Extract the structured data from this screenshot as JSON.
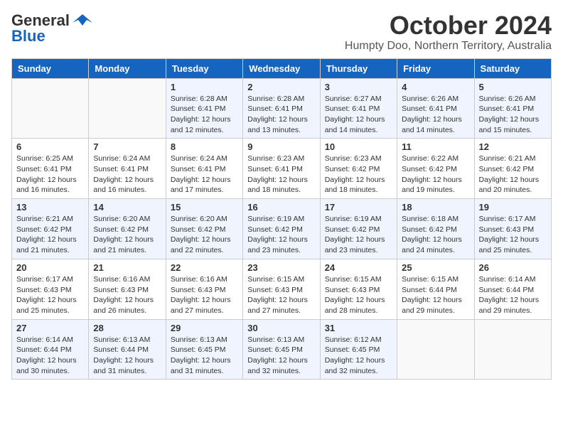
{
  "logo": {
    "text_general": "General",
    "text_blue": "Blue"
  },
  "title": "October 2024",
  "subtitle": "Humpty Doo, Northern Territory, Australia",
  "days": [
    "Sunday",
    "Monday",
    "Tuesday",
    "Wednesday",
    "Thursday",
    "Friday",
    "Saturday"
  ],
  "weeks": [
    [
      {
        "date": "",
        "sunrise": "",
        "sunset": "",
        "daylight": ""
      },
      {
        "date": "",
        "sunrise": "",
        "sunset": "",
        "daylight": ""
      },
      {
        "date": "1",
        "sunrise": "Sunrise: 6:28 AM",
        "sunset": "Sunset: 6:41 PM",
        "daylight": "Daylight: 12 hours and 12 minutes."
      },
      {
        "date": "2",
        "sunrise": "Sunrise: 6:28 AM",
        "sunset": "Sunset: 6:41 PM",
        "daylight": "Daylight: 12 hours and 13 minutes."
      },
      {
        "date": "3",
        "sunrise": "Sunrise: 6:27 AM",
        "sunset": "Sunset: 6:41 PM",
        "daylight": "Daylight: 12 hours and 14 minutes."
      },
      {
        "date": "4",
        "sunrise": "Sunrise: 6:26 AM",
        "sunset": "Sunset: 6:41 PM",
        "daylight": "Daylight: 12 hours and 14 minutes."
      },
      {
        "date": "5",
        "sunrise": "Sunrise: 6:26 AM",
        "sunset": "Sunset: 6:41 PM",
        "daylight": "Daylight: 12 hours and 15 minutes."
      }
    ],
    [
      {
        "date": "6",
        "sunrise": "Sunrise: 6:25 AM",
        "sunset": "Sunset: 6:41 PM",
        "daylight": "Daylight: 12 hours and 16 minutes."
      },
      {
        "date": "7",
        "sunrise": "Sunrise: 6:24 AM",
        "sunset": "Sunset: 6:41 PM",
        "daylight": "Daylight: 12 hours and 16 minutes."
      },
      {
        "date": "8",
        "sunrise": "Sunrise: 6:24 AM",
        "sunset": "Sunset: 6:41 PM",
        "daylight": "Daylight: 12 hours and 17 minutes."
      },
      {
        "date": "9",
        "sunrise": "Sunrise: 6:23 AM",
        "sunset": "Sunset: 6:41 PM",
        "daylight": "Daylight: 12 hours and 18 minutes."
      },
      {
        "date": "10",
        "sunrise": "Sunrise: 6:23 AM",
        "sunset": "Sunset: 6:42 PM",
        "daylight": "Daylight: 12 hours and 18 minutes."
      },
      {
        "date": "11",
        "sunrise": "Sunrise: 6:22 AM",
        "sunset": "Sunset: 6:42 PM",
        "daylight": "Daylight: 12 hours and 19 minutes."
      },
      {
        "date": "12",
        "sunrise": "Sunrise: 6:21 AM",
        "sunset": "Sunset: 6:42 PM",
        "daylight": "Daylight: 12 hours and 20 minutes."
      }
    ],
    [
      {
        "date": "13",
        "sunrise": "Sunrise: 6:21 AM",
        "sunset": "Sunset: 6:42 PM",
        "daylight": "Daylight: 12 hours and 21 minutes."
      },
      {
        "date": "14",
        "sunrise": "Sunrise: 6:20 AM",
        "sunset": "Sunset: 6:42 PM",
        "daylight": "Daylight: 12 hours and 21 minutes."
      },
      {
        "date": "15",
        "sunrise": "Sunrise: 6:20 AM",
        "sunset": "Sunset: 6:42 PM",
        "daylight": "Daylight: 12 hours and 22 minutes."
      },
      {
        "date": "16",
        "sunrise": "Sunrise: 6:19 AM",
        "sunset": "Sunset: 6:42 PM",
        "daylight": "Daylight: 12 hours and 23 minutes."
      },
      {
        "date": "17",
        "sunrise": "Sunrise: 6:19 AM",
        "sunset": "Sunset: 6:42 PM",
        "daylight": "Daylight: 12 hours and 23 minutes."
      },
      {
        "date": "18",
        "sunrise": "Sunrise: 6:18 AM",
        "sunset": "Sunset: 6:42 PM",
        "daylight": "Daylight: 12 hours and 24 minutes."
      },
      {
        "date": "19",
        "sunrise": "Sunrise: 6:17 AM",
        "sunset": "Sunset: 6:43 PM",
        "daylight": "Daylight: 12 hours and 25 minutes."
      }
    ],
    [
      {
        "date": "20",
        "sunrise": "Sunrise: 6:17 AM",
        "sunset": "Sunset: 6:43 PM",
        "daylight": "Daylight: 12 hours and 25 minutes."
      },
      {
        "date": "21",
        "sunrise": "Sunrise: 6:16 AM",
        "sunset": "Sunset: 6:43 PM",
        "daylight": "Daylight: 12 hours and 26 minutes."
      },
      {
        "date": "22",
        "sunrise": "Sunrise: 6:16 AM",
        "sunset": "Sunset: 6:43 PM",
        "daylight": "Daylight: 12 hours and 27 minutes."
      },
      {
        "date": "23",
        "sunrise": "Sunrise: 6:15 AM",
        "sunset": "Sunset: 6:43 PM",
        "daylight": "Daylight: 12 hours and 27 minutes."
      },
      {
        "date": "24",
        "sunrise": "Sunrise: 6:15 AM",
        "sunset": "Sunset: 6:43 PM",
        "daylight": "Daylight: 12 hours and 28 minutes."
      },
      {
        "date": "25",
        "sunrise": "Sunrise: 6:15 AM",
        "sunset": "Sunset: 6:44 PM",
        "daylight": "Daylight: 12 hours and 29 minutes."
      },
      {
        "date": "26",
        "sunrise": "Sunrise: 6:14 AM",
        "sunset": "Sunset: 6:44 PM",
        "daylight": "Daylight: 12 hours and 29 minutes."
      }
    ],
    [
      {
        "date": "27",
        "sunrise": "Sunrise: 6:14 AM",
        "sunset": "Sunset: 6:44 PM",
        "daylight": "Daylight: 12 hours and 30 minutes."
      },
      {
        "date": "28",
        "sunrise": "Sunrise: 6:13 AM",
        "sunset": "Sunset: 6:44 PM",
        "daylight": "Daylight: 12 hours and 31 minutes."
      },
      {
        "date": "29",
        "sunrise": "Sunrise: 6:13 AM",
        "sunset": "Sunset: 6:45 PM",
        "daylight": "Daylight: 12 hours and 31 minutes."
      },
      {
        "date": "30",
        "sunrise": "Sunrise: 6:13 AM",
        "sunset": "Sunset: 6:45 PM",
        "daylight": "Daylight: 12 hours and 32 minutes."
      },
      {
        "date": "31",
        "sunrise": "Sunrise: 6:12 AM",
        "sunset": "Sunset: 6:45 PM",
        "daylight": "Daylight: 12 hours and 32 minutes."
      },
      {
        "date": "",
        "sunrise": "",
        "sunset": "",
        "daylight": ""
      },
      {
        "date": "",
        "sunrise": "",
        "sunset": "",
        "daylight": ""
      }
    ]
  ]
}
